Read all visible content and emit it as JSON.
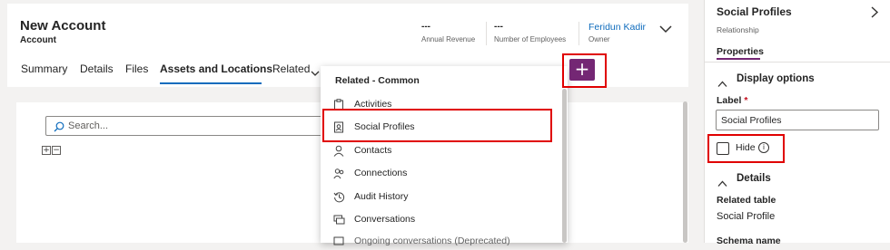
{
  "record": {
    "title": "New Account",
    "entity": "Account",
    "stats": [
      {
        "value": "---",
        "label": "Annual Revenue"
      },
      {
        "value": "---",
        "label": "Number of Employees"
      }
    ],
    "owner": {
      "name": "Feridun Kadir",
      "label": "Owner"
    }
  },
  "tabs": [
    {
      "label": "Summary"
    },
    {
      "label": "Details"
    },
    {
      "label": "Files"
    },
    {
      "label": "Assets and Locations"
    },
    {
      "label": "Related"
    }
  ],
  "search": {
    "placeholder": "Search..."
  },
  "tree": {
    "expand": "+",
    "collapse": "−"
  },
  "dropdown": {
    "header": "Related - Common",
    "items": [
      {
        "label": "Activities",
        "icon": "clipboard-icon"
      },
      {
        "label": "Social Profiles",
        "icon": "social-profile-icon"
      },
      {
        "label": "Contacts",
        "icon": "person-icon"
      },
      {
        "label": "Connections",
        "icon": "people-icon"
      },
      {
        "label": "Audit History",
        "icon": "history-icon"
      },
      {
        "label": "Conversations",
        "icon": "chat-icon"
      },
      {
        "label": "Ongoing conversations (Deprecated)",
        "icon": "chat-icon"
      }
    ]
  },
  "add_button": {
    "label": "+"
  },
  "panel": {
    "title": "Social Profiles",
    "subtitle": "Relationship",
    "tab": "Properties",
    "display_options": "Display options",
    "label_field": {
      "label": "Label",
      "required": "*",
      "value": "Social Profiles"
    },
    "hide": {
      "label": "Hide",
      "checked": false
    },
    "details": "Details",
    "related_table": {
      "label": "Related table",
      "value": "Social Profile"
    },
    "schema_name": {
      "label": "Schema name"
    }
  },
  "colors": {
    "accent": "#742774",
    "link": "#0f6cbd",
    "highlight": "#e00000"
  }
}
